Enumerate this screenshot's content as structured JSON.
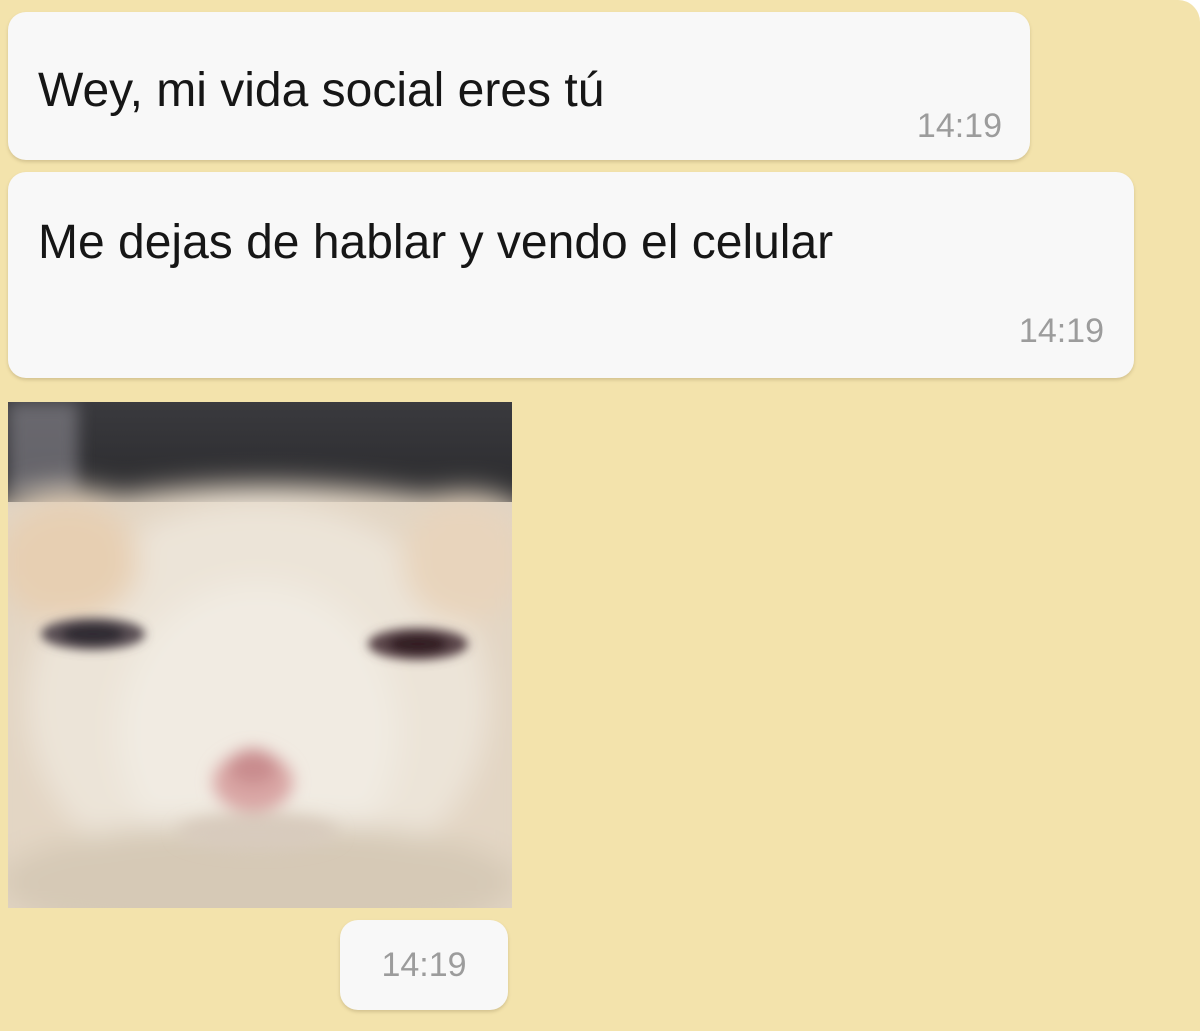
{
  "chat": {
    "background_color": "#f3e3ac",
    "bubble_color": "#f8f8f8",
    "messages": [
      {
        "text": "Wey, mi vida social eres tú",
        "time": "14:19"
      },
      {
        "text": "Me dejas de hablar y vendo el celular",
        "time": "14:19"
      }
    ],
    "image_message": {
      "image": "blurry-white-cat-photo",
      "time": "14:19"
    }
  }
}
